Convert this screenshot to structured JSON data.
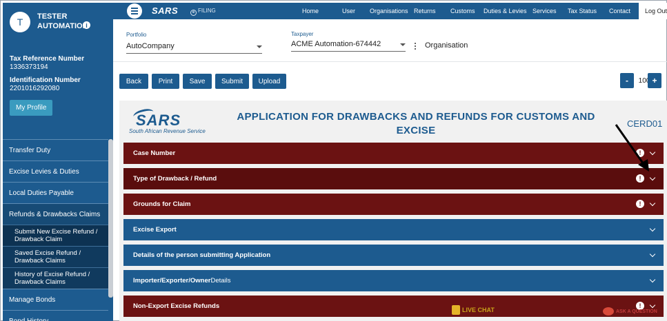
{
  "sidebar": {
    "avatar_letter": "T",
    "user_name": "TESTER AUTOMATION",
    "info_glyph": "i",
    "tax_ref_label": "Tax Reference Number",
    "tax_ref_value": "1336373194",
    "id_label": "Identification Number",
    "id_value": "2201016292080",
    "profile_button": "My Profile",
    "menu": [
      {
        "label": "Transfer Duty"
      },
      {
        "label": "Excise Levies & Duties"
      },
      {
        "label": "Local Duties Payable"
      },
      {
        "label": "Refunds & Drawbacks Claims"
      }
    ],
    "submenu": [
      {
        "label": "Submit New Excise Refund / Drawback Claim"
      },
      {
        "label": "Saved Excise Refund / Drawback Claims"
      },
      {
        "label": "History of Excise Refund / Drawback Claims"
      }
    ],
    "menu_after": [
      {
        "label": "Manage Bonds"
      },
      {
        "label": "Bond History"
      }
    ]
  },
  "topnav": {
    "logo": "SARS",
    "efiling": "FILING",
    "efiling_glyph": "e",
    "links": [
      "Home",
      "User",
      "Organisations",
      "Returns",
      "Customs",
      "Duties & Levies",
      "Services",
      "Tax Status",
      "Contact"
    ],
    "logout": "Log Out"
  },
  "selectors": {
    "portfolio_label": "Portfolio",
    "portfolio_value": "AutoCompany",
    "taxpayer_label": "Taxpayer",
    "taxpayer_value": "ACME Automation-674442",
    "org_label": "Organisation"
  },
  "toolbar": {
    "buttons": [
      "Back",
      "Print",
      "Save",
      "Submit",
      "Upload"
    ],
    "zoom_minus": "-",
    "zoom_value": "100",
    "zoom_plus": "+"
  },
  "form": {
    "logo": "SARS",
    "logo_sub": "South African Revenue Service",
    "title": "APPLICATION FOR DRAWBACKS AND REFUNDS FOR CUSTOMS AND EXCISE",
    "code": "CERD01",
    "sections": [
      {
        "label": "Case Number",
        "alert": "!",
        "color": "#6b1212"
      },
      {
        "label": "Type of Drawback / Refund",
        "alert": "!",
        "color": "#5a0d0d"
      },
      {
        "label": "Grounds for Claim",
        "alert": "!",
        "color": "#6b1212"
      },
      {
        "label": "Excise Export",
        "color": "#1d5b8f"
      },
      {
        "label": "Details of the person submitting Application",
        "color": "#1d5b8f"
      },
      {
        "label_bold": "Importer/Exporter/Owner",
        "label_normal": " Details",
        "color": "#1d5b8f"
      },
      {
        "label": "Non-Export Excise Refunds",
        "alert": "!",
        "color": "#6b1212"
      }
    ]
  },
  "widgets": {
    "live_chat": "LIVE CHAT",
    "ask_question": "ASK A QUESTION"
  },
  "colors": {
    "primary_blue": "#1d5b8f",
    "maroon": "#6b1212"
  }
}
